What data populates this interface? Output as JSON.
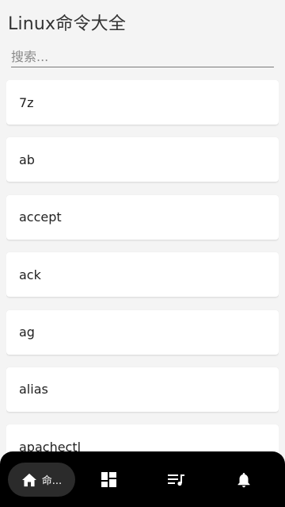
{
  "header": {
    "title": "Linux命令大全"
  },
  "search": {
    "placeholder": "搜索..."
  },
  "commands": [
    {
      "name": "7z"
    },
    {
      "name": "ab"
    },
    {
      "name": "accept"
    },
    {
      "name": "ack"
    },
    {
      "name": "ag"
    },
    {
      "name": "alias"
    },
    {
      "name": "apachectl"
    }
  ],
  "bottom_nav": {
    "items": [
      {
        "label": "命...",
        "icon": "home-icon",
        "active": true
      },
      {
        "icon": "dashboard-icon",
        "active": false
      },
      {
        "icon": "queue-music-icon",
        "active": false
      },
      {
        "icon": "bell-icon",
        "active": false
      }
    ]
  },
  "colors": {
    "background": "#f4f4f4",
    "card": "#ffffff",
    "nav_background": "#000000",
    "nav_active_pill": "#2b2b2b",
    "nav_icon": "#ffffff"
  }
}
